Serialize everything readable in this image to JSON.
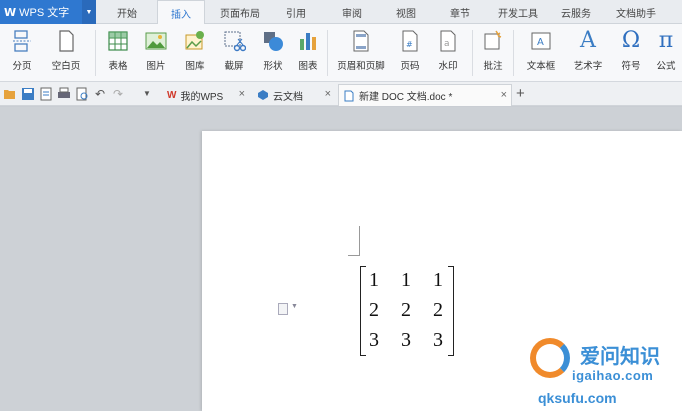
{
  "app": {
    "title": "WPS 文字",
    "logo": "W"
  },
  "menu_tabs": [
    "开始",
    "插入",
    "页面布局",
    "引用",
    "审阅",
    "视图",
    "章节",
    "开发工具",
    "云服务",
    "文档助手"
  ],
  "active_tab": "插入",
  "ribbon": {
    "page_break": "分页",
    "blank_page": "空白页",
    "table": "表格",
    "picture": "图片",
    "gallery": "图库",
    "screenshot": "截屏",
    "shapes": "形状",
    "chart": "图表",
    "header_footer": "页眉和页脚",
    "page_number": "页码",
    "watermark": "水印",
    "comment": "批注",
    "textbox": "文本框",
    "wordart": "艺术字",
    "symbol": "符号",
    "formula": "公式",
    "symbol_glyph": "Ω",
    "formula_glyph": "π",
    "wordart_glyph": "A"
  },
  "doc_tabs": [
    {
      "label": "我的WPS",
      "icon": "W"
    },
    {
      "label": "云文档"
    },
    {
      "label": "新建 DOC 文档.doc *"
    }
  ],
  "matrix": {
    "rows": [
      [
        "1",
        "1",
        "1"
      ],
      [
        "2",
        "2",
        "2"
      ],
      [
        "3",
        "3",
        "3"
      ]
    ]
  },
  "watermark": {
    "brand": "爱问知识",
    "url": "igaihao.com",
    "url2": "qksufu.com"
  },
  "colors": {
    "accent": "#2f78d0",
    "ribbon_bg": "#f7f8fa",
    "workspace": "#cdd1d6"
  }
}
